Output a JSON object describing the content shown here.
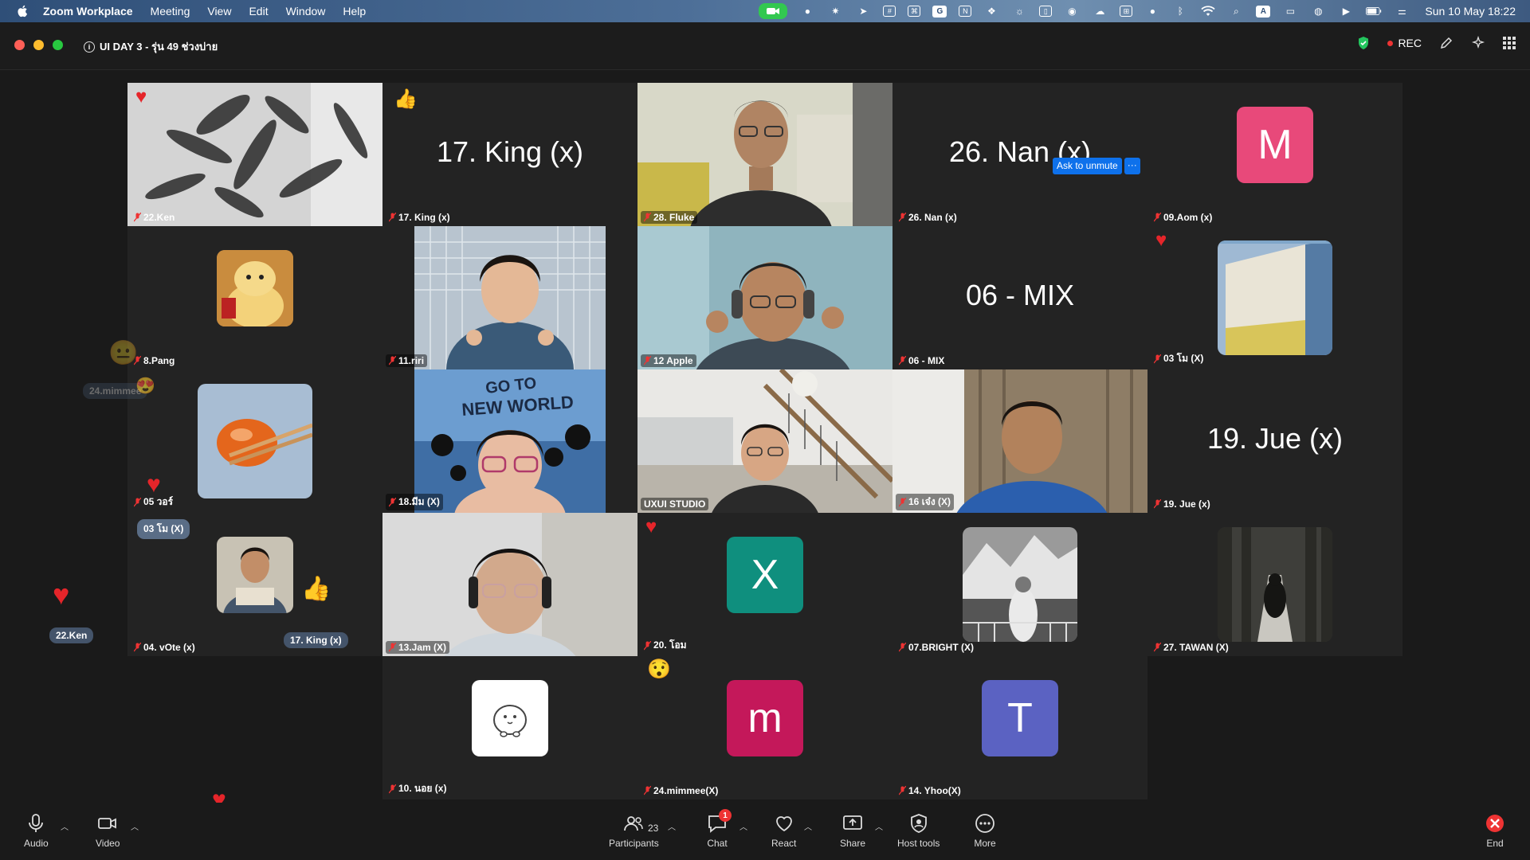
{
  "menubar": {
    "app": "Zoom Workplace",
    "items": [
      "Meeting",
      "View",
      "Edit",
      "Window",
      "Help"
    ],
    "clock": "Sun 10 May  18:22",
    "input_letter": "A"
  },
  "window": {
    "title": "UI DAY 3 - รุ่น 49 ช่วงบ่าย",
    "rec_label": "REC"
  },
  "grid": {
    "ask_unmute": "Ask to unmute",
    "ask_more": "···",
    "tiles": [
      {
        "name": "22.Ken"
      },
      {
        "name": "17. King (x)",
        "big": "17. King (x)"
      },
      {
        "name": "28. Fluke"
      },
      {
        "name": "26. Nan (x)",
        "big": "26. Nan (x)"
      },
      {
        "name": "09.Aom (x)",
        "avatar": "M"
      },
      {
        "name": "8.Pang"
      },
      {
        "name": "11.riri"
      },
      {
        "name": "12 Apple"
      },
      {
        "name": "06 - MIX",
        "big": "06 - MIX"
      },
      {
        "name": "03 โม (X)"
      },
      {
        "name": "05 วอร์"
      },
      {
        "name": "18.มีม (X)"
      },
      {
        "name": "UXUI STUDIO"
      },
      {
        "name": "16 เจ๋ง (X)"
      },
      {
        "name": "19. Jue (x)",
        "big": "19. Jue (x)"
      },
      {
        "name": "04. vOte (x)"
      },
      {
        "name": "13.Jam (X)"
      },
      {
        "name": "20. โอม",
        "avatar": "X"
      },
      {
        "name": "07.BRIGHT (X)"
      },
      {
        "name": "27. TAWAN (X)"
      },
      {
        "name": "10. นอย (x)"
      },
      {
        "name": "24.mimmee(X)",
        "avatar": "m"
      },
      {
        "name": "14. Yhoo(X)",
        "avatar": "T"
      }
    ],
    "floating": {
      "mimmee": "24.mimmee",
      "mo": "03 โม (X)",
      "king": "17. King (x)",
      "ken": "22.Ken"
    }
  },
  "toolbar": {
    "audio": "Audio",
    "video": "Video",
    "participants": "Participants",
    "participant_count": "23",
    "chat": "Chat",
    "chat_badge": "1",
    "react": "React",
    "share": "Share",
    "host_tools": "Host tools",
    "more": "More",
    "end": "End"
  },
  "colors": {
    "tile_bg": "#232323",
    "active_border": "#3ccf4e",
    "avatar_M": "#e8497a",
    "avatar_X": "#0f8f7e",
    "avatar_m": "#c4185a",
    "avatar_T": "#5b62c2",
    "zoom_blue": "#0e71eb",
    "end_red": "#e33"
  }
}
